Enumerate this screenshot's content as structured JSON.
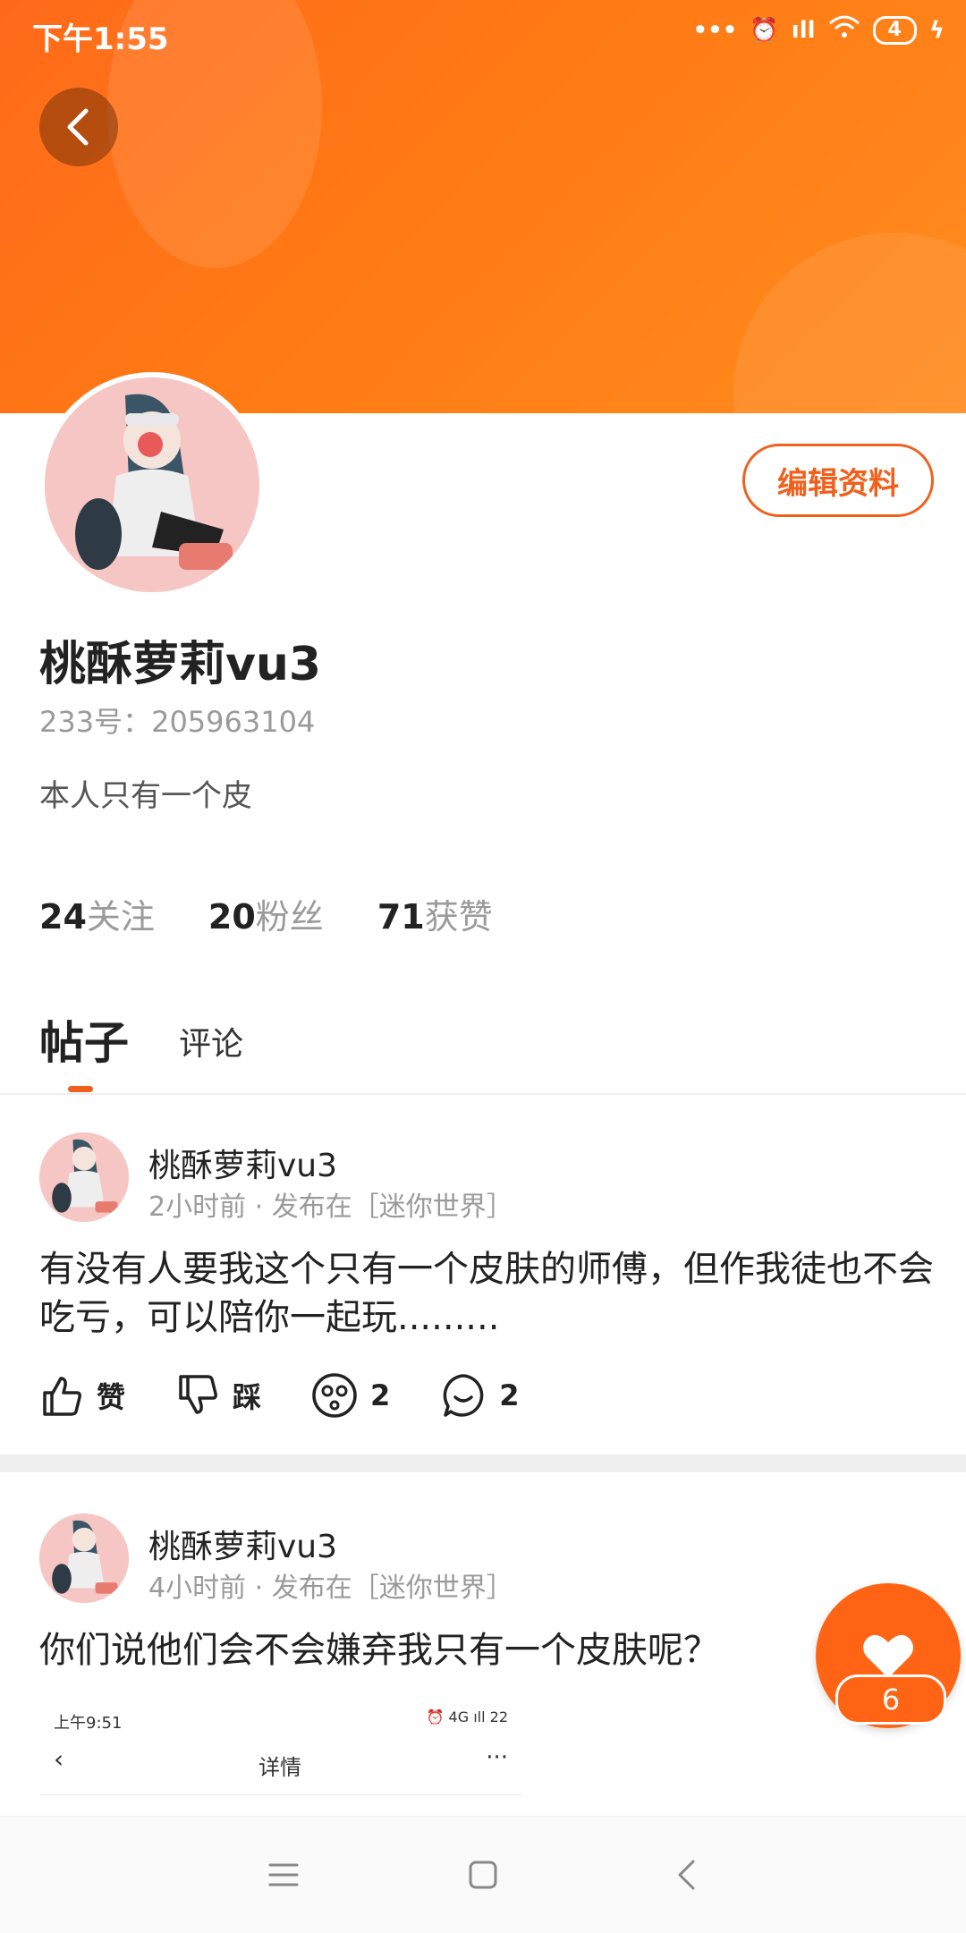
{
  "status_bar": {
    "time": "下午1:55",
    "battery": "4"
  },
  "profile": {
    "username": "桃酥萝莉vu3",
    "uid_text": "233号：205963104",
    "bio": "本人只有一个皮",
    "edit_button": "编辑资料",
    "stats": [
      {
        "num": "24",
        "label": "关注"
      },
      {
        "num": "20",
        "label": "粉丝"
      },
      {
        "num": "71",
        "label": "获赞"
      }
    ]
  },
  "tabs": {
    "posts": "帖子",
    "comments": "评论"
  },
  "posts": [
    {
      "author": "桃酥萝莉vu3",
      "meta": "2小时前 · 发布在［迷你世界］",
      "text": "有没有人要我这个只有一个皮肤的师傅，但作我徒也不会吃亏，可以陪你一起玩.........",
      "actions": {
        "like": "赞",
        "dislike": "踩",
        "reactions": "2",
        "comments": "2"
      }
    },
    {
      "author": "桃酥萝莉vu3",
      "meta": "4小时前 · 发布在［迷你世界］",
      "text": "你们说他们会不会嫌弃我只有一个皮肤呢？",
      "preview": {
        "time": "上午9:51",
        "icons": "⏰ 4G ıll 22",
        "title": "详情",
        "more": "···"
      }
    }
  ],
  "floating_like": {
    "count": "6"
  },
  "colors": {
    "accent": "#ff6414",
    "banner": "#ff7a14"
  }
}
